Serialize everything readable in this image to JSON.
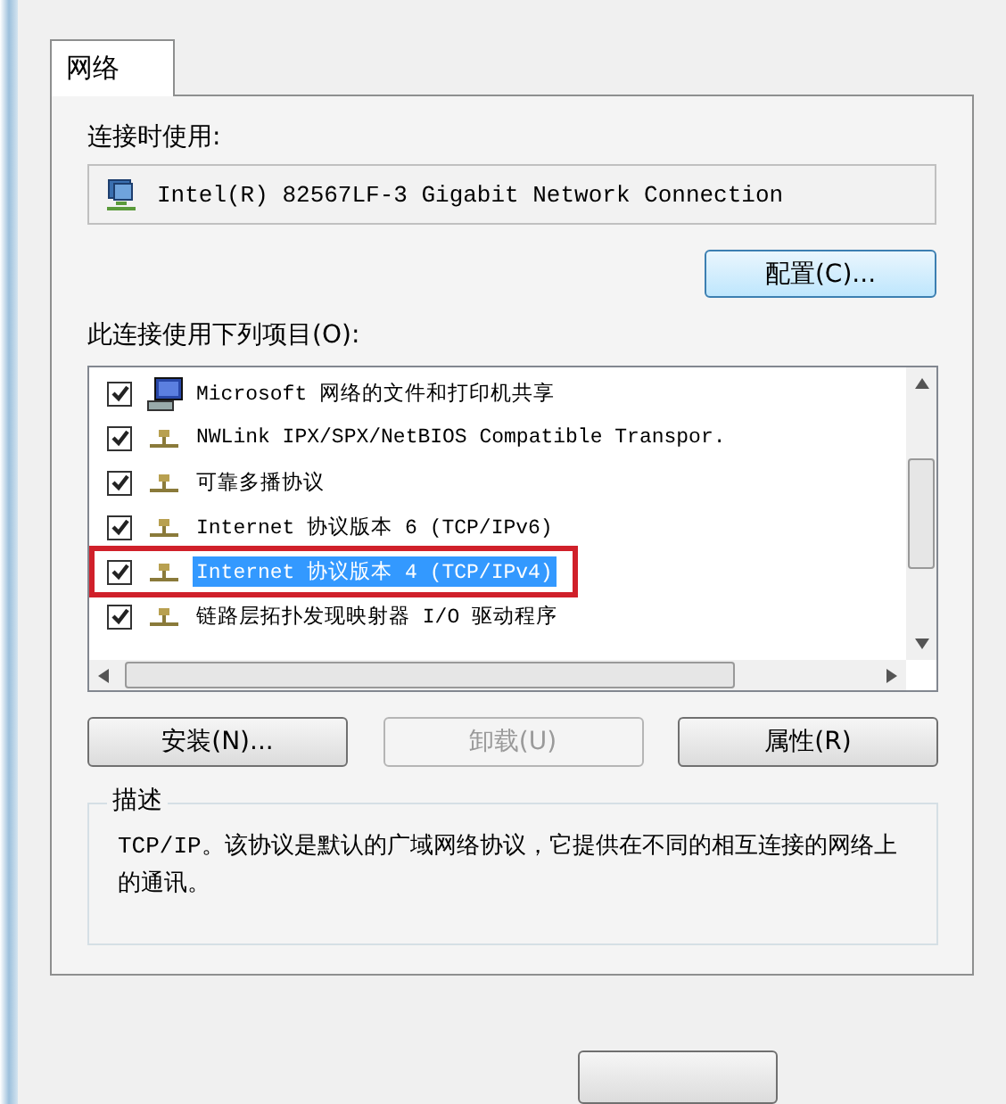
{
  "tabs": [
    {
      "label": "网络",
      "selected": true
    }
  ],
  "connect_using": {
    "label": "连接时使用:",
    "adapter": "Intel(R) 82567LF-3 Gigabit Network Connection",
    "configure_button": "配置(C)..."
  },
  "items_list": {
    "label": "此连接使用下列项目(O):",
    "items": [
      {
        "kind": "service",
        "label": "Microsoft 网络的文件和打印机共享",
        "checked": true,
        "selected": false,
        "marked": false
      },
      {
        "kind": "protocol",
        "label": "NWLink IPX/SPX/NetBIOS Compatible Transpor.",
        "checked": true,
        "selected": false,
        "marked": false
      },
      {
        "kind": "protocol",
        "label": "可靠多播协议",
        "checked": true,
        "selected": false,
        "marked": false
      },
      {
        "kind": "protocol",
        "label": "Internet 协议版本 6 (TCP/IPv6)",
        "checked": true,
        "selected": false,
        "marked": false
      },
      {
        "kind": "protocol",
        "label": "Internet 协议版本 4 (TCP/IPv4)",
        "checked": true,
        "selected": true,
        "marked": true
      },
      {
        "kind": "protocol",
        "label": "链路层拓扑发现映射器 I/O 驱动程序",
        "checked": true,
        "selected": false,
        "marked": false
      }
    ]
  },
  "buttons": [
    {
      "label": "安装(N)...",
      "disabled": false
    },
    {
      "label": "卸载(U)",
      "disabled": true
    },
    {
      "label": "属性(R)",
      "disabled": false
    }
  ],
  "description": {
    "title": "描述",
    "text": "TCP/IP。该协议是默认的广域网络协议，它提供在不同的相互连接的网络上的通讯。"
  }
}
